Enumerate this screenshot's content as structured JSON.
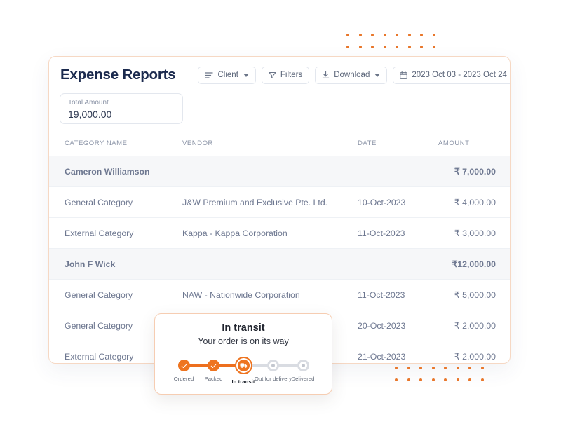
{
  "header": {
    "title": "Expense Reports",
    "toolbar": [
      {
        "name": "client",
        "label": "Client",
        "icon": "sort-lines-icon",
        "has_caret": true
      },
      {
        "name": "filters",
        "label": "Filters",
        "icon": "funnel-icon",
        "has_caret": false
      },
      {
        "name": "download",
        "label": "Download",
        "icon": "download-icon",
        "has_caret": true
      },
      {
        "name": "date-range",
        "label": "2023 Oct 03 - 2023 Oct 24",
        "icon": "calendar-icon",
        "has_caret": false
      }
    ]
  },
  "total_amount": {
    "label": "Total Amount",
    "value": "19,000.00"
  },
  "table": {
    "columns": [
      "CATEGORY NAME",
      "VENDOR",
      "DATE",
      "AMOUNT"
    ],
    "rows": [
      {
        "type": "group",
        "category": "Cameron Williamson",
        "vendor": "",
        "date": "",
        "amount": "₹ 7,000.00"
      },
      {
        "type": "item",
        "category": "General Category",
        "vendor": "J&W Premium and Exclusive Pte. Ltd.",
        "date": "10-Oct-2023",
        "amount": "₹ 4,000.00"
      },
      {
        "type": "item",
        "category": "External Category",
        "vendor": "Kappa - Kappa Corporation",
        "date": "11-Oct-2023",
        "amount": "₹ 3,000.00"
      },
      {
        "type": "group",
        "category": "John F Wick",
        "vendor": "",
        "date": "",
        "amount": "₹12,000.00"
      },
      {
        "type": "item",
        "category": "General Category",
        "vendor": "NAW - Nationwide Corporation",
        "date": "11-Oct-2023",
        "amount": "₹ 5,000.00"
      },
      {
        "type": "item",
        "category": "General Category",
        "vendor": "",
        "date": "20-Oct-2023",
        "amount": "₹ 2,000.00"
      },
      {
        "type": "item",
        "category": "External Category",
        "vendor": "",
        "date": "21-Oct-2023",
        "amount": "₹ 2,000.00"
      }
    ]
  },
  "in_transit": {
    "title": "In transit",
    "subtitle": "Your order is on its way",
    "steps": [
      {
        "label": "Ordered",
        "state": "done"
      },
      {
        "label": "Packed",
        "state": "done"
      },
      {
        "label": "In transit",
        "state": "current"
      },
      {
        "label": "Out for delivery",
        "state": "pending"
      },
      {
        "label": "Delivered",
        "state": "pending"
      }
    ]
  },
  "colors": {
    "accent": "#ee7420",
    "dot": "#e8762a",
    "title": "#1b2a4e",
    "muted": "#8a93a6",
    "group_row_bg": "#f6f7f9",
    "card_border": "#f6d8c4",
    "track": "#d9dce2"
  }
}
